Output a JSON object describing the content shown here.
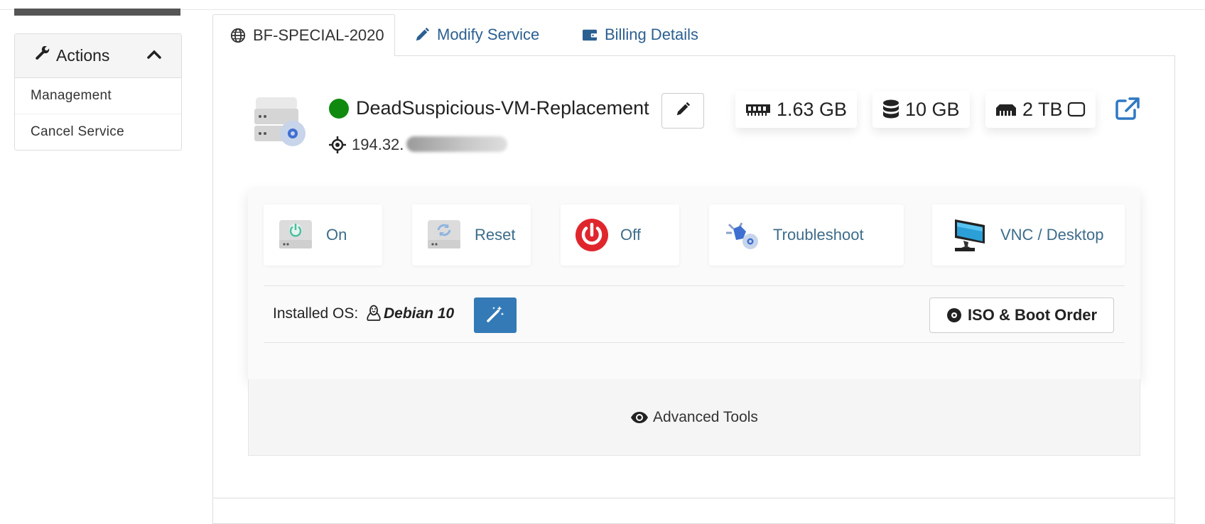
{
  "sidebar": {
    "title": "Actions",
    "items": [
      {
        "label": "Management"
      },
      {
        "label": "Cancel Service"
      }
    ]
  },
  "tabs": [
    {
      "label": "BF-SPECIAL-2020",
      "icon": "globe-icon",
      "active": true
    },
    {
      "label": "Modify Service",
      "icon": "pencil-icon",
      "active": false
    },
    {
      "label": "Billing Details",
      "icon": "wallet-icon",
      "active": false
    }
  ],
  "vm": {
    "name": "DeadSuspicious-VM-Replacement",
    "status_color": "#0f8a0f",
    "ip_visible": "194.32."
  },
  "specs": [
    {
      "icon": "memory-icon",
      "value": "1.63 GB"
    },
    {
      "icon": "database-icon",
      "value": "10 GB"
    },
    {
      "icon": "network-port-icon",
      "value": "2 TB"
    }
  ],
  "power": [
    {
      "label": "On",
      "icon": "power-on-icon"
    },
    {
      "label": "Reset",
      "icon": "reset-icon"
    },
    {
      "label": "Off",
      "icon": "power-off-icon"
    },
    {
      "label": "Troubleshoot",
      "icon": "troubleshoot-icon"
    },
    {
      "label": "VNC / Desktop",
      "icon": "monitor-icon"
    }
  ],
  "os": {
    "label": "Installed OS:",
    "name": "Debian 10"
  },
  "iso_button": "ISO & Boot Order",
  "advanced": "Advanced Tools",
  "colors": {
    "link": "#2b5f91",
    "primary": "#337ab7",
    "off_red": "#e0262d",
    "status_green": "#0f8a0f"
  }
}
